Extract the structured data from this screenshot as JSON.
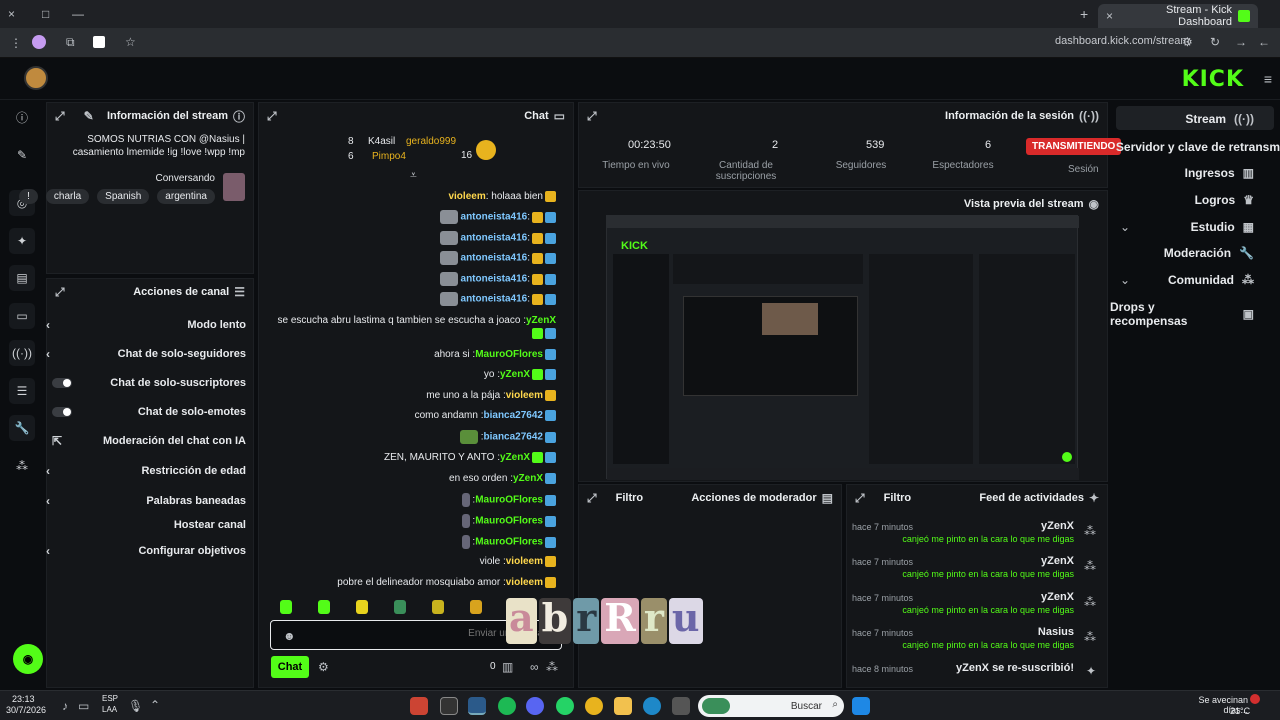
{
  "browser": {
    "tab_title": "Stream - Kick Dashboard",
    "url": "dashboard.kick.com/stream",
    "new_tab": "+",
    "close_tab": "×",
    "window_min": "—",
    "window_max": "□",
    "window_close": "×"
  },
  "brand": {
    "logo": "KICK",
    "accent": "#53fc18"
  },
  "nav": {
    "items": [
      {
        "label": "Stream",
        "icon": "broadcast-icon"
      },
      {
        "label": "Servidor y clave de retransm",
        "icon": ""
      },
      {
        "label": "Ingresos",
        "icon": "chart-icon"
      },
      {
        "label": "Logros",
        "icon": "trophy-icon"
      },
      {
        "label": "Estudio",
        "icon": "studio-icon"
      },
      {
        "label": "Moderación",
        "icon": "wrench-icon"
      },
      {
        "label": "Comunidad",
        "icon": "people-icon"
      },
      {
        "label": "Drops y recompensas",
        "icon": "gift-icon"
      }
    ]
  },
  "stream_info": {
    "title": "Información del stream",
    "text": "SOMOS NUTRIAS CON @Nasius | casamiento lmemide !ig !love !wpp !mp",
    "category": "Conversando",
    "tags": [
      "argentina",
      "Spanish",
      "charla"
    ],
    "tag_extra": "!"
  },
  "channel_actions": {
    "title": "Acciones de canal",
    "items": [
      {
        "label": "Modo lento",
        "control": "chevron"
      },
      {
        "label": "Chat de solo-seguidores",
        "control": "chevron"
      },
      {
        "label": "Chat de solo-suscriptores",
        "control": "toggle"
      },
      {
        "label": "Chat de solo-emotes",
        "control": "toggle"
      },
      {
        "label": "Moderación del chat con IA",
        "control": "external"
      },
      {
        "label": "Restricción de edad",
        "control": "chevron"
      },
      {
        "label": "Palabras baneadas",
        "control": "chevron"
      },
      {
        "label": "Hostear canal",
        "control": "none"
      },
      {
        "label": "Configurar objetivos",
        "control": "chevron"
      }
    ]
  },
  "chat": {
    "title": "Chat",
    "top_gifters": [
      {
        "name": "geraldo999",
        "count": "16"
      },
      {
        "name": "K4asil",
        "count": "8"
      },
      {
        "name": "Pimpo4",
        "count": "6"
      }
    ],
    "messages": [
      {
        "user": "violeem",
        "text": "holaaa bien",
        "color": "#ffd84d"
      },
      {
        "user": "antoneista416",
        "text": "",
        "color": "#7fc8ff",
        "emote": true
      },
      {
        "user": "antoneista416",
        "text": "",
        "color": "#7fc8ff",
        "emote": true
      },
      {
        "user": "antoneista416",
        "text": "",
        "color": "#7fc8ff",
        "emote": true
      },
      {
        "user": "antoneista416",
        "text": "",
        "color": "#7fc8ff",
        "emote": true
      },
      {
        "user": "antoneista416",
        "text": "",
        "color": "#7fc8ff",
        "emote": true
      },
      {
        "user": "yZenX",
        "text": "se escucha abru lastima q tambien se escucha a joaco",
        "color": "#53fc18"
      },
      {
        "user": "MauroOFlores",
        "text": "ahora si",
        "color": "#53fc18"
      },
      {
        "user": "yZenX",
        "text": "yo",
        "color": "#53fc18"
      },
      {
        "user": "violeem",
        "text": "me uno a la pája",
        "color": "#ffd84d"
      },
      {
        "user": "bianca27642",
        "text": "como andamn",
        "color": "#7fc8ff"
      },
      {
        "user": "bianca27642",
        "text": "",
        "color": "#7fc8ff",
        "emote": true
      },
      {
        "user": "yZenX",
        "text": "ZEN, MAURITO Y ANTO",
        "color": "#53fc18"
      },
      {
        "user": "yZenX",
        "text": "en eso orden",
        "color": "#53fc18"
      },
      {
        "user": "MauroOFlores",
        "text": "",
        "color": "#53fc18",
        "emote": true
      },
      {
        "user": "MauroOFlores",
        "text": "",
        "color": "#53fc18",
        "emote": true
      },
      {
        "user": "MauroOFlores",
        "text": "",
        "color": "#53fc18",
        "emote": true
      },
      {
        "user": "violeem",
        "text": "viole",
        "color": "#ffd84d"
      },
      {
        "user": "violeem",
        "text": "pobre el delineador mosquiabo amor",
        "color": "#ffd84d"
      }
    ],
    "input_placeholder": "Enviar un mensaje",
    "send_label": "Chat",
    "points": "0"
  },
  "session": {
    "title": "Información de la sesión",
    "status": "TRANSMITIENDO",
    "status_sub": "Sesión",
    "stats": [
      {
        "value": "6",
        "label": "Espectadores"
      },
      {
        "value": "539",
        "label": "Seguidores"
      },
      {
        "value": "2",
        "label": "Cantidad de suscripciones"
      },
      {
        "value": "00:23:50",
        "label": "Tiempo en vivo"
      }
    ]
  },
  "preview": {
    "title": "Vista previa del stream"
  },
  "activity_feed": {
    "title": "Feed de actividades",
    "filter": "Filtro",
    "items": [
      {
        "user": "yZenX",
        "time": "hace 7 minutos",
        "text": "canjeó me pinto en la cara lo que me digas"
      },
      {
        "user": "yZenX",
        "time": "hace 7 minutos",
        "text": "canjeó me pinto en la cara lo que me digas"
      },
      {
        "user": "yZenX",
        "time": "hace 7 minutos",
        "text": "canjeó me pinto en la cara lo que me digas"
      },
      {
        "user": "Nasius",
        "time": "hace 7 minutos",
        "text": "canjeó me pinto en la cara lo que me digas"
      },
      {
        "user": "yZenX se re-suscribió!",
        "time": "hace 8 minutos",
        "text": ""
      }
    ]
  },
  "mod_actions": {
    "title": "Acciones de moderador",
    "filter": "Filtro"
  },
  "overlay_sticker": "abrRru",
  "taskbar": {
    "search": "Buscar",
    "time": "23:13",
    "date": "30/7/2026",
    "lang": "ESP",
    "lang2": "LAA",
    "notif": "Se avecinan días...",
    "temp": "21°C"
  }
}
